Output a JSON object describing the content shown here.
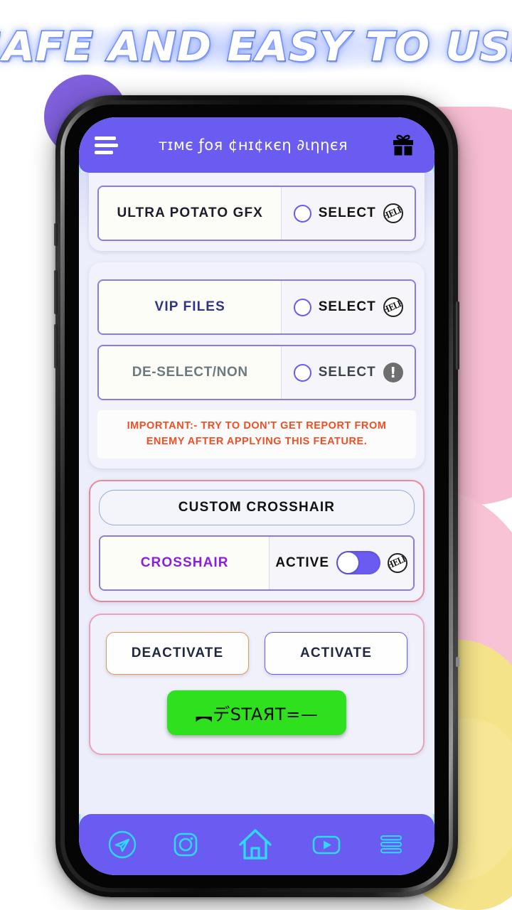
{
  "banner": {
    "text": "SAFE AND EASY TO USE"
  },
  "colors": {
    "header_purple": "#6a5cf0",
    "accent_purple": "#8b7ae8",
    "nav_icon_cyan": "#2fd8ff",
    "warning_orange": "#f04e23",
    "start_green": "#2fe01f",
    "crosshair_border_pink": "#e9889b",
    "deactivate_border_orange": "#e29a5e",
    "label_navy": "#2f3488",
    "label_slate": "#6b7a80",
    "label_purple": "#8a1fe0",
    "blob_purple": "#7f5fdb",
    "blob_pink": "#f7bdd2",
    "blob_yellow": "#f5e38a"
  },
  "header": {
    "title": "ᴛɪмє ƒоя ¢нɪ¢кєη ∂ιηηєя",
    "menu_icon": "hamburger-icon",
    "gift_icon": "gift-icon"
  },
  "gfx_section": {
    "rows": [
      {
        "label": "ULTRA POTATO GFX",
        "control_label": "SELECT",
        "control_type": "radio",
        "selected": false,
        "badge": "HELP",
        "badge_type": "help"
      }
    ]
  },
  "files_section": {
    "rows": [
      {
        "label": "VIP FILES",
        "control_label": "SELECT",
        "control_type": "radio",
        "selected": false,
        "badge": "HELP",
        "badge_type": "help"
      },
      {
        "label": "DE-SELECT/NON",
        "control_label": "SELECT",
        "control_type": "radio",
        "selected": false,
        "badge": "!",
        "badge_type": "warning"
      }
    ],
    "important": {
      "line1": "IMPORTANT:- TRY TO DON'T GET REPORT FROM",
      "line2": "ENEMY AFTER APPLYING THIS FEATURE."
    }
  },
  "crosshair_section": {
    "heading": "CUSTOM CROSSHAIR",
    "rows": [
      {
        "label": "CROSSHAIR",
        "control_label": "ACTIVE",
        "control_type": "toggle",
        "toggle_on": true,
        "badge": "HELP",
        "badge_type": "help"
      }
    ]
  },
  "actions_section": {
    "deactivate_label": "DEACTIVATE",
    "activate_label": "ACTIVATE",
    "start_label": "︻デSTAЯT=—"
  },
  "bottom_nav": {
    "items": [
      {
        "name": "telegram-icon"
      },
      {
        "name": "instagram-icon"
      },
      {
        "name": "home-icon"
      },
      {
        "name": "youtube-icon"
      },
      {
        "name": "menu-lines-icon"
      }
    ]
  }
}
